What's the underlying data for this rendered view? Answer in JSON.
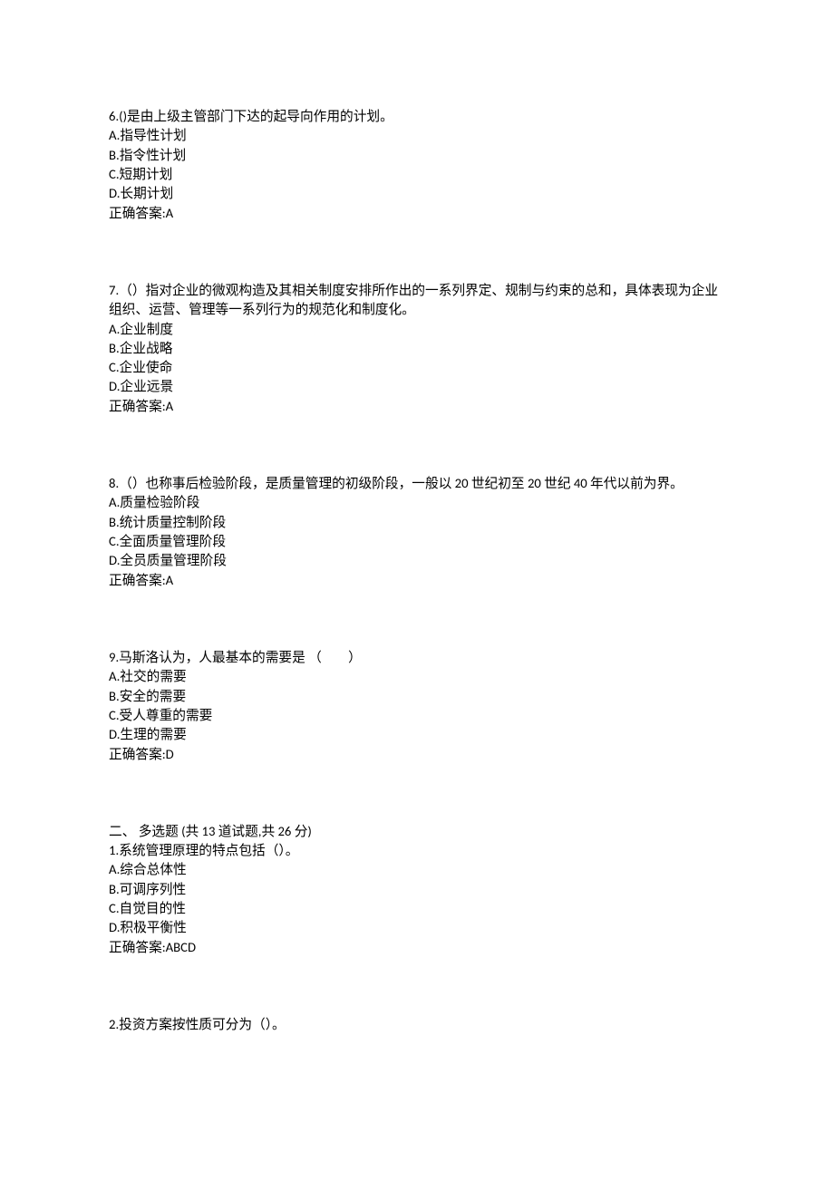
{
  "questions": [
    {
      "stem": "6.()是由上级主管部门下达的起导向作用的计划。",
      "options": [
        "A.指导性计划",
        "B.指令性计划",
        "C.短期计划",
        "D.长期计划"
      ],
      "answer": "正确答案:A"
    },
    {
      "stem": "7.（）指对企业的微观构造及其相关制度安排所作出的一系列界定、规制与约束的总和，具体表现为企业组织、运营、管理等一系列行为的规范化和制度化。",
      "options": [
        "A.企业制度",
        "B.企业战略",
        "C.企业使命",
        "D.企业远景"
      ],
      "answer": "正确答案:A"
    },
    {
      "stem": "8.（）也称事后检验阶段，是质量管理的初级阶段，一般以 20 世纪初至 20 世纪 40 年代以前为界。",
      "options": [
        "A.质量检验阶段",
        "B.统计质量控制阶段",
        "C.全面质量管理阶段",
        "D.全员质量管理阶段"
      ],
      "answer": "正确答案:A"
    },
    {
      "stem": "9.马斯洛认为，人最基本的需要是 （　　）",
      "options": [
        "A.社交的需要",
        "B.安全的需要",
        "C.受人尊重的需要",
        "D.生理的需要"
      ],
      "answer": "正确答案:D"
    }
  ],
  "section2": {
    "header": "二、  多选题  (共  13  道试题,共  26  分)",
    "questions": [
      {
        "stem": "1.系统管理原理的特点包括（）。",
        "options": [
          "A.综合总体性",
          "B.可调序列性",
          "C.自觉目的性",
          "D.积极平衡性"
        ],
        "answer": "正确答案:ABCD"
      },
      {
        "stem": "2.投资方案按性质可分为（）。"
      }
    ]
  }
}
